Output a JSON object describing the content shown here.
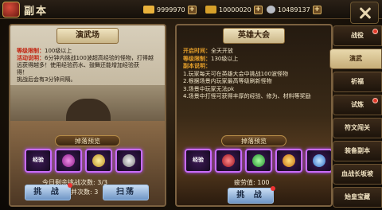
{
  "header": {
    "title": "副本",
    "resources": [
      {
        "icon": "gold-ingot-icon",
        "value": "9999970",
        "color": "#e9b23c"
      },
      {
        "icon": "gold-bar-icon",
        "value": "10000020",
        "color": "#d6a02a"
      },
      {
        "icon": "silver-coin-icon",
        "value": "10489137",
        "color": "#b8bcc4"
      }
    ]
  },
  "left_panel": {
    "title": "演武场",
    "info": [
      {
        "key": "等级限制",
        "value": "100级以上"
      },
      {
        "key": "活动说明",
        "value": "6分钟内挑战100波超高经验的怪物，打得越"
      },
      {
        "key": "",
        "value": "远获得越多！使用经验药水、鼓舞还能增加经验获"
      },
      {
        "key": "",
        "value": "得！"
      },
      {
        "key": "",
        "value": "挑战后会有3分钟间隔。"
      }
    ],
    "drop_title": "掉落预览",
    "items": [
      {
        "label": "经验",
        "color": "#5cff8a"
      },
      {
        "label": "",
        "color": "#d24bc9"
      },
      {
        "label": "",
        "color": "#e6c34a"
      },
      {
        "label": "",
        "color": "#b8b8b8"
      }
    ],
    "remaining_label": "今日剩余挑战次数:",
    "remaining_value": "3/3",
    "merge_label": "合并次数:",
    "merge_value": "3",
    "btn_challenge": "挑 战",
    "btn_sweep": "扫荡"
  },
  "right_panel": {
    "title": "英雄大会",
    "info": [
      {
        "key": "开启时间",
        "value": "全天开放"
      },
      {
        "key": "等级限制",
        "value": "130级以上"
      },
      {
        "key": "副本说明",
        "value": ""
      },
      {
        "key": "",
        "value": "1.玩家每天可在英雄大会中挑战100波怪物"
      },
      {
        "key": "",
        "value": "2.根据场景内玩家最高等级刷新怪物"
      },
      {
        "key": "",
        "value": "3.场景中玩家无法pk"
      },
      {
        "key": "",
        "value": "4.场景中打怪可获得丰厚的经验、修为、材料等奖励"
      }
    ],
    "drop_title": "掉落预览",
    "items": [
      {
        "label": "经验",
        "color": "#5cff8a"
      },
      {
        "label": "",
        "color": "#e0283a"
      },
      {
        "label": "",
        "color": "#4fdc5a"
      },
      {
        "label": "",
        "color": "#ffb22a"
      },
      {
        "label": "",
        "color": "#6fb8ff"
      }
    ],
    "fatigue_label": "疲劳值:",
    "fatigue_value": "100",
    "btn_challenge": "挑 战"
  },
  "sidebar": {
    "tabs": [
      {
        "label": "战役",
        "active": false,
        "dot": true
      },
      {
        "label": "演武",
        "active": true,
        "dot": false
      },
      {
        "label": "祈福",
        "active": false,
        "dot": false
      },
      {
        "label": "试炼",
        "active": false,
        "dot": true
      },
      {
        "label": "符文闯关",
        "active": false,
        "dot": false
      },
      {
        "label": "装备副本",
        "active": false,
        "dot": false
      },
      {
        "label": "血战长坂坡",
        "active": false,
        "dot": false
      },
      {
        "label": "始皇宝藏",
        "active": false,
        "dot": false
      }
    ]
  }
}
